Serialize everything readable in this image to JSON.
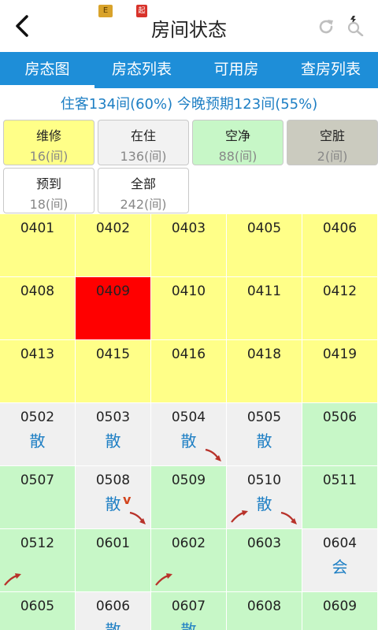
{
  "header": {
    "title": "房间状态",
    "notif_a": "E",
    "notif_b": "起"
  },
  "tabs": [
    {
      "label": "房态图",
      "active": true
    },
    {
      "label": "房态列表",
      "active": false
    },
    {
      "label": "可用房",
      "active": false
    },
    {
      "label": "查房列表",
      "active": false
    }
  ],
  "summary": "住客134间(60%) 今晚预期123间(55%)",
  "filters": {
    "repair": {
      "label": "维修",
      "count": "16(间)",
      "color": "#ffff88"
    },
    "occupied": {
      "label": "在住",
      "count": "136(间)",
      "color": "#f2f2f2"
    },
    "clean": {
      "label": "空净",
      "count": "88(间)",
      "color": "#c7f7c7"
    },
    "dirty": {
      "label": "空脏",
      "count": "2(间)",
      "color": "#cbcbbf"
    },
    "arrival": {
      "label": "预到",
      "count": "18(间)",
      "color": "#ffffff"
    },
    "all": {
      "label": "全部",
      "count": "242(间)",
      "color": "#ffffff"
    }
  },
  "rooms": [
    {
      "num": "0401",
      "status": "yellow"
    },
    {
      "num": "0402",
      "status": "yellow"
    },
    {
      "num": "0403",
      "status": "yellow"
    },
    {
      "num": "0405",
      "status": "yellow"
    },
    {
      "num": "0406",
      "status": "yellow"
    },
    {
      "num": "0408",
      "status": "yellow"
    },
    {
      "num": "0409",
      "status": "red"
    },
    {
      "num": "0410",
      "status": "yellow"
    },
    {
      "num": "0411",
      "status": "yellow"
    },
    {
      "num": "0412",
      "status": "yellow"
    },
    {
      "num": "0413",
      "status": "yellow"
    },
    {
      "num": "0415",
      "status": "yellow"
    },
    {
      "num": "0416",
      "status": "yellow"
    },
    {
      "num": "0418",
      "status": "yellow"
    },
    {
      "num": "0419",
      "status": "yellow"
    },
    {
      "num": "0502",
      "status": "gray",
      "tag": "散"
    },
    {
      "num": "0503",
      "status": "gray",
      "tag": "散"
    },
    {
      "num": "0504",
      "status": "gray",
      "tag": "散",
      "arrow": "br"
    },
    {
      "num": "0505",
      "status": "gray",
      "tag": "散"
    },
    {
      "num": "0506",
      "status": "green"
    },
    {
      "num": "0507",
      "status": "green"
    },
    {
      "num": "0508",
      "status": "gray",
      "tag": "散",
      "vmark": "v",
      "arrow": "br"
    },
    {
      "num": "0509",
      "status": "green"
    },
    {
      "num": "0510",
      "status": "gray",
      "tag": "散",
      "arrow": "bl",
      "arrow2": "br"
    },
    {
      "num": "0511",
      "status": "green"
    },
    {
      "num": "0512",
      "status": "green",
      "arrow": "bl"
    },
    {
      "num": "0601",
      "status": "green"
    },
    {
      "num": "0602",
      "status": "green",
      "arrow": "bl"
    },
    {
      "num": "0603",
      "status": "green"
    },
    {
      "num": "0604",
      "status": "gray",
      "tag": "会"
    },
    {
      "num": "0605",
      "status": "green"
    },
    {
      "num": "0606",
      "status": "gray",
      "tag": "散"
    },
    {
      "num": "0607",
      "status": "green",
      "tag": "散"
    },
    {
      "num": "0608",
      "status": "green"
    },
    {
      "num": "0609",
      "status": "green"
    }
  ],
  "icons": {
    "back": "chevron-left-icon",
    "refresh": "refresh-icon",
    "search": "search-icon",
    "arrow": "red-curved-arrow-icon"
  }
}
